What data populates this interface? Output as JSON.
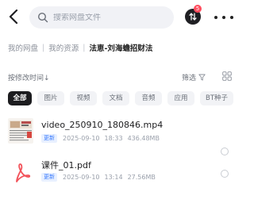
{
  "search": {
    "placeholder": "搜索网盘文件"
  },
  "header": {
    "transfer_badge": "5"
  },
  "breadcrumb": {
    "items": [
      "我的网盘",
      "我的资源"
    ],
    "current": "法恵-刘海蟾招财法"
  },
  "sort": {
    "label": "按修改时间↓",
    "filter_label": "筛选"
  },
  "chips": [
    "全部",
    "图片",
    "视频",
    "文档",
    "音频",
    "应用",
    "BT种子"
  ],
  "files": [
    {
      "name": "video_250910_180846.mp4",
      "tag": "更新",
      "date": "2025-09-10",
      "time": "18:33",
      "size": "436.48MB"
    },
    {
      "name": "课件_01.pdf",
      "tag": "更新",
      "date": "2025-09-10",
      "time": "13:14",
      "size": "27.56MB"
    }
  ],
  "colors": {
    "accent": "#3a7bfd",
    "badge": "#ff4d5e",
    "chip_active": "#1c1c1f",
    "pdf": "#f2525a"
  },
  "icons": {
    "back": "chevron-left-icon",
    "search": "search-icon",
    "transfer": "transfer-icon",
    "more": "more-dots-icon",
    "filter": "filter-icon",
    "grid": "grid-view-icon"
  }
}
